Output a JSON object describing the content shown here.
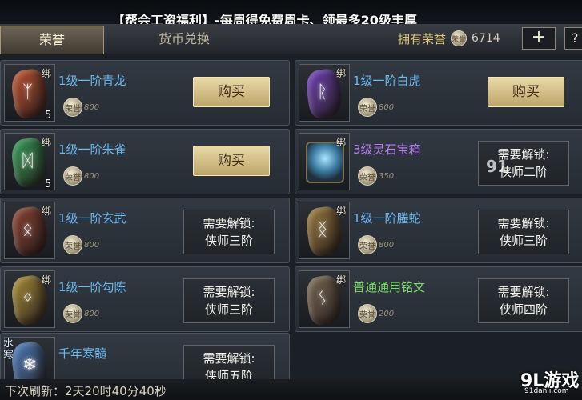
{
  "banner": {
    "text": "【帮会工资福利】-每周得免费周卡、领最多20级丰厚"
  },
  "tabs": [
    {
      "label": "荣誉"
    },
    {
      "label": "货币兑换"
    }
  ],
  "currency": {
    "label": "拥有荣誉",
    "coin_glyph": "荣誉",
    "amount": "6714"
  },
  "header_buttons": {
    "plus": "+",
    "help": "?"
  },
  "items": [
    {
      "name": "1级一阶青龙",
      "name_color": "#6ab8f0",
      "bind": "绑",
      "count": "5",
      "price": "800",
      "action_type": "buy",
      "action_label": "购买",
      "icon": "dragon-rune-icon",
      "rune_color": "#c0522e"
    },
    {
      "name": "1级一阶白虎",
      "name_color": "#6ab8f0",
      "bind": "绑",
      "count": "",
      "price": "800",
      "action_type": "buy",
      "action_label": "购买",
      "icon": "tiger-rune-icon",
      "rune_color": "#6c3fb8"
    },
    {
      "name": "1级一阶朱雀",
      "name_color": "#6ab8f0",
      "bind": "绑",
      "count": "5",
      "price": "800",
      "action_type": "buy",
      "action_label": "购买",
      "icon": "phoenix-rune-icon",
      "rune_color": "#2e9a52"
    },
    {
      "name": "3级灵石宝箱",
      "name_color": "#b77cf0",
      "bind": "绑",
      "count": "",
      "price": "350",
      "action_type": "locked",
      "lock_line1": "需要解锁:",
      "lock_line2": "侠师二阶",
      "icon": "spirit-stone-chest-icon",
      "rune_color": "#3a7aa0"
    },
    {
      "name": "1级一阶玄武",
      "name_color": "#6ab8f0",
      "bind": "绑",
      "count": "",
      "price": "800",
      "action_type": "locked",
      "lock_line1": "需要解锁:",
      "lock_line2": "侠师三阶",
      "icon": "tortoise-rune-icon",
      "rune_color": "#8a4030"
    },
    {
      "name": "1级一阶螣蛇",
      "name_color": "#6ab8f0",
      "bind": "绑",
      "count": "",
      "price": "800",
      "action_type": "locked",
      "lock_line1": "需要解锁:",
      "lock_line2": "侠师三阶",
      "icon": "serpent-rune-icon",
      "rune_color": "#9a7a3a"
    },
    {
      "name": "1级一阶勾陈",
      "name_color": "#6ab8f0",
      "bind": "绑",
      "count": "",
      "price": "800",
      "action_type": "locked",
      "lock_line1": "需要解锁:",
      "lock_line2": "侠师三阶",
      "icon": "gouchen-rune-icon",
      "rune_color": "#a88e35"
    },
    {
      "name": "普通通用铭文",
      "name_color": "#7fdc6a",
      "bind": "绑",
      "count": "",
      "price": "200",
      "action_type": "locked",
      "lock_line1": "需要解锁:",
      "lock_line2": "侠师四阶",
      "icon": "general-inscription-icon",
      "rune_color": "#7a6a52"
    },
    {
      "name": "千年寒髓",
      "name_color": "#6ab8f0",
      "bind": "",
      "count": "",
      "price": "",
      "action_type": "locked",
      "lock_line1": "需要解锁:",
      "lock_line2": "侠师五阶",
      "icon": "ice-marrow-icon",
      "rune_color": "#4a7fc0",
      "tag": "水寒"
    }
  ],
  "footer": {
    "text": "下次刷新：2天20时40分40秒"
  },
  "watermark": {
    "brand": "9L游戏",
    "url": "91danji.com",
    "mid": "91"
  }
}
